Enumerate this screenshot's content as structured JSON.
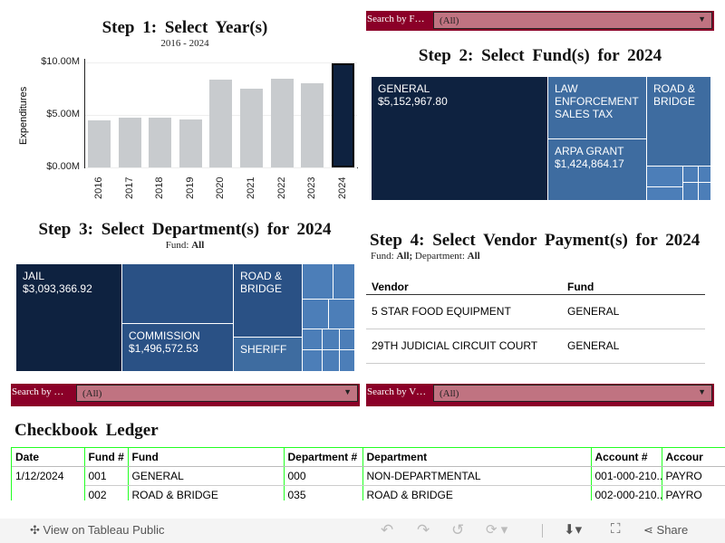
{
  "step1": {
    "title": "Step 1: Select Year(s)",
    "subtitle": "2016 - 2024",
    "ylabel": "Expenditures"
  },
  "chart_data": {
    "type": "bar",
    "title": "Step 1: Select Year(s)",
    "subtitle": "2016 - 2024",
    "ylabel": "Expenditures",
    "xlabel": "",
    "ylim": [
      0,
      10
    ],
    "yticks": [
      "$0.00M",
      "$5.00M",
      "$10.00M"
    ],
    "categories": [
      "2016",
      "2017",
      "2018",
      "2019",
      "2020",
      "2021",
      "2022",
      "2023",
      "2024"
    ],
    "values": [
      4.45,
      4.7,
      4.7,
      4.55,
      8.35,
      7.5,
      8.45,
      8.0,
      9.95
    ],
    "units": "$M",
    "selected": "2024",
    "colors": {
      "bar": "#c8cbce",
      "selected": "#0e2240"
    }
  },
  "step2": {
    "title": "Step 2: Select Fund(s) for 2024",
    "filter_label": "Search by F…",
    "filter_value": "(All)",
    "tiles": [
      {
        "name": "GENERAL",
        "value": "$5,152,967.80"
      },
      {
        "name": "LAW ENFORCEMENT SALES TAX"
      },
      {
        "name": "ARPA GRANT",
        "value": "$1,424,864.17"
      },
      {
        "name": "ROAD & BRIDGE"
      }
    ]
  },
  "step3": {
    "title": "Step 3: Select Department(s) for 2024",
    "fund_label": "Fund:",
    "fund_value": "All",
    "filter_label": "Search by …",
    "filter_value": "(All)",
    "tiles": [
      {
        "name": "JAIL",
        "value": "$3,093,366.92"
      },
      {
        "name": "COMMISSION",
        "value": "$1,496,572.53"
      },
      {
        "name": "ROAD & BRIDGE"
      },
      {
        "name": "SHERIFF"
      }
    ]
  },
  "step4": {
    "title": "Step 4: Select Vendor Payment(s) for 2024",
    "fund_label": "Fund:",
    "fund_value": "All;",
    "dept_label": "Department:",
    "dept_value": "All",
    "filter_label": "Search by V…",
    "filter_value": "(All)",
    "headers": [
      "Vendor",
      "Fund"
    ],
    "rows": [
      [
        "5 STAR FOOD EQUIPMENT",
        "GENERAL"
      ],
      [
        "29TH JUDICIAL CIRCUIT COURT",
        "GENERAL"
      ]
    ]
  },
  "ledger": {
    "title": "Checkbook Ledger",
    "headers": [
      "Date",
      "Fund #",
      "Fund",
      "Department #",
      "Department",
      "Account #",
      "Accour"
    ],
    "rows": [
      [
        "1/12/2024",
        "001",
        "GENERAL",
        "000",
        "NON-DEPARTMENTAL",
        "001-000-210..",
        "PAYRO"
      ],
      [
        "",
        "002",
        "ROAD & BRIDGE",
        "035",
        "ROAD & BRIDGE",
        "002-000-210..",
        "PAYRO"
      ]
    ]
  },
  "toolbar": {
    "view_label": "View on Tableau Public",
    "share_label": "Share"
  }
}
